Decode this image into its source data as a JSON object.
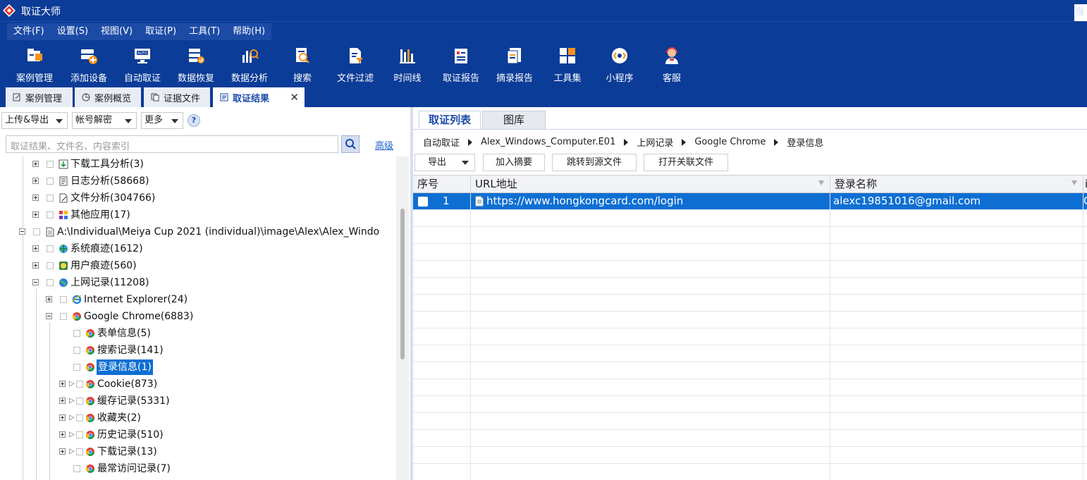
{
  "app": {
    "title": "取证大师",
    "right_text": "当"
  },
  "menu": [
    "文件(F)",
    "设置(S)",
    "视图(V)",
    "取证(P)",
    "工具(T)",
    "帮助(H)"
  ],
  "toolbar": [
    {
      "label": "案例管理",
      "icon": "case-icon"
    },
    {
      "label": "添加设备",
      "icon": "add-device-icon"
    },
    {
      "label": "自动取证",
      "icon": "auto-icon"
    },
    {
      "label": "数据恢复",
      "icon": "recovery-icon"
    },
    {
      "label": "数据分析",
      "icon": "analysis-icon"
    },
    {
      "label": "搜索",
      "icon": "search-icon"
    },
    {
      "label": "文件过滤",
      "icon": "filter-icon"
    },
    {
      "label": "时间线",
      "icon": "timeline-icon"
    },
    {
      "label": "取证报告",
      "icon": "report-icon"
    },
    {
      "label": "摘录报告",
      "icon": "excerpt-icon"
    },
    {
      "label": "工具集",
      "icon": "toolset-icon"
    },
    {
      "label": "小程序",
      "icon": "miniprogram-icon"
    },
    {
      "label": "客服",
      "icon": "support-icon"
    }
  ],
  "tabs": [
    {
      "label": "案例管理"
    },
    {
      "label": "案例概览"
    },
    {
      "label": "证据文件"
    },
    {
      "label": "取证结果",
      "close": "✕"
    }
  ],
  "left": {
    "buttons": [
      "上传&导出",
      "帐号解密",
      "更多"
    ],
    "help": "?",
    "search_placeholder": "取证结果、文件名、内容索引",
    "advanced": "高级",
    "tree": [
      "下载工具分析(3)",
      "日志分析(58668)",
      "文件分析(304766)",
      "其他应用(17)",
      "A:\\Individual\\Meiya Cup 2021 (individual)\\image\\Alex\\Alex_Windo",
      "系统痕迹(1612)",
      "用户痕迹(560)",
      "上网记录(11208)",
      "Internet Explorer(24)",
      "Google Chrome(6883)",
      "表单信息(5)",
      "搜索记录(141)",
      "登录信息(1)",
      "Cookie(873)",
      "缓存记录(5331)",
      "收藏夹(2)",
      "历史记录(510)",
      "下载记录(13)",
      "最常访问记录(7)"
    ]
  },
  "right": {
    "tabs": [
      "取证列表",
      "图库"
    ],
    "breadcrumb": [
      "自动取证",
      "Alex_Windows_Computer.E01",
      "上网记录",
      "Google Chrome",
      "登录信息"
    ],
    "buttons": [
      "导出",
      "加入摘要",
      "跳转到源文件",
      "打开关联文件"
    ],
    "columns": [
      "序号",
      "URL地址",
      "登录名称",
      "i"
    ],
    "rows": [
      {
        "index": "1",
        "url": "https://www.hongkongcard.com/login",
        "login": "alexc19851016@gmail.com",
        "extra": "C"
      }
    ]
  },
  "colors": {
    "brand": "#0b3c97",
    "selection": "#0e6fd3"
  }
}
